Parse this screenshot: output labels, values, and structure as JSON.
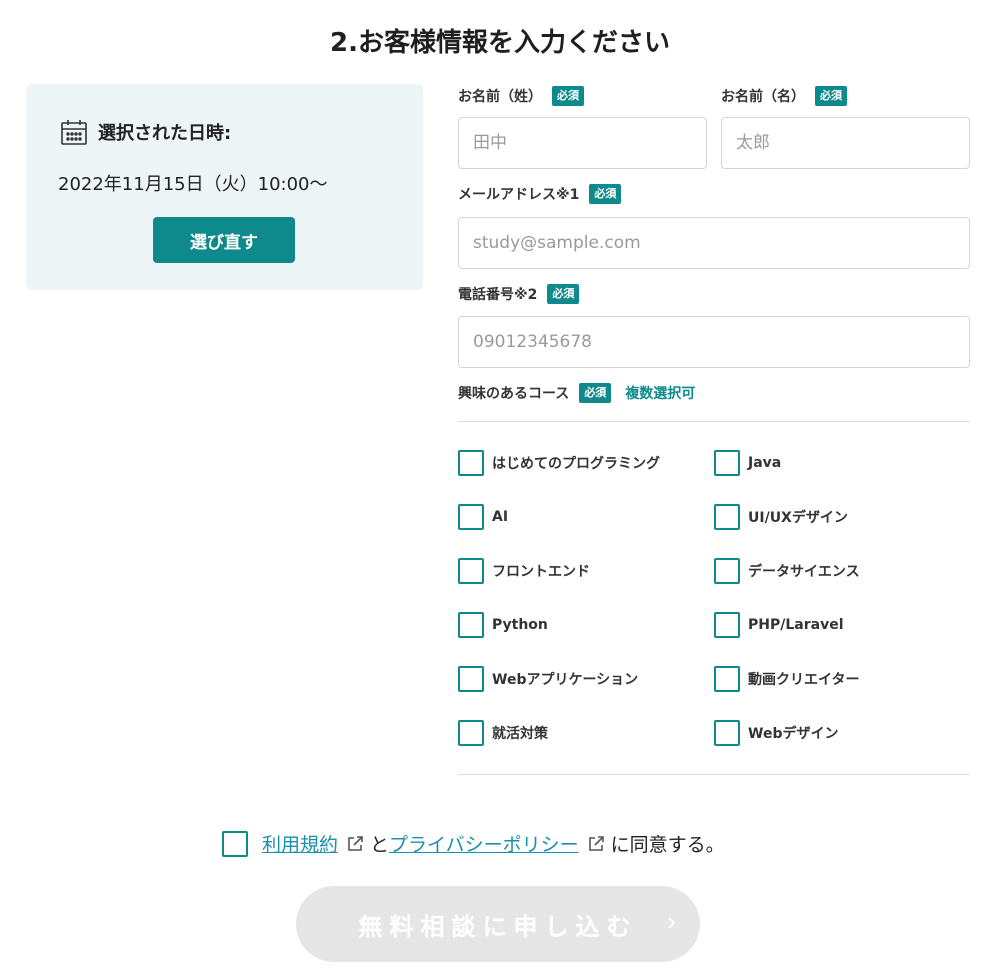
{
  "section": {
    "title": "2.お客様情報を入力ください"
  },
  "selected": {
    "label": "選択された日時:",
    "datetime": "2022年11月15日（火）10:00〜",
    "reselect_label": "選び直す",
    "icon": "calendar-icon"
  },
  "form": {
    "required_badge": "必須",
    "last_name": {
      "label": "お名前（姓）",
      "placeholder": "田中",
      "value": ""
    },
    "first_name": {
      "label": "お名前（名）",
      "placeholder": "太郎",
      "value": ""
    },
    "email": {
      "label": "メールアドレス※1",
      "placeholder": "study@sample.com",
      "value": ""
    },
    "phone": {
      "label": "電話番号※2",
      "placeholder": "09012345678",
      "value": ""
    },
    "courses": {
      "label": "興味のあるコース",
      "note": "複数選択可",
      "items": [
        {
          "label": "はじめてのプログラミング",
          "checked": false
        },
        {
          "label": "Java",
          "checked": false
        },
        {
          "label": "AI",
          "checked": false
        },
        {
          "label": "UI/UXデザイン",
          "checked": false
        },
        {
          "label": "フロントエンド",
          "checked": false
        },
        {
          "label": "データサイエンス",
          "checked": false
        },
        {
          "label": "Python",
          "checked": false
        },
        {
          "label": "PHP/Laravel",
          "checked": false
        },
        {
          "label": "Webアプリケーション",
          "checked": false
        },
        {
          "label": "動画クリエイター",
          "checked": false
        },
        {
          "label": "就活対策",
          "checked": false
        },
        {
          "label": "Webデザイン",
          "checked": false
        }
      ]
    }
  },
  "agreement": {
    "terms_link": "利用規約",
    "connector": "と",
    "privacy_link": "プライバシーポリシー",
    "suffix": "に同意する。",
    "checked": false
  },
  "submit": {
    "label": "無料相談に申し込む",
    "enabled": false
  },
  "colors": {
    "accent": "#0e8a8c",
    "link": "#1a8fb0",
    "panel_bg": "#eef5f6",
    "disabled_button": "#e6e6e6"
  }
}
